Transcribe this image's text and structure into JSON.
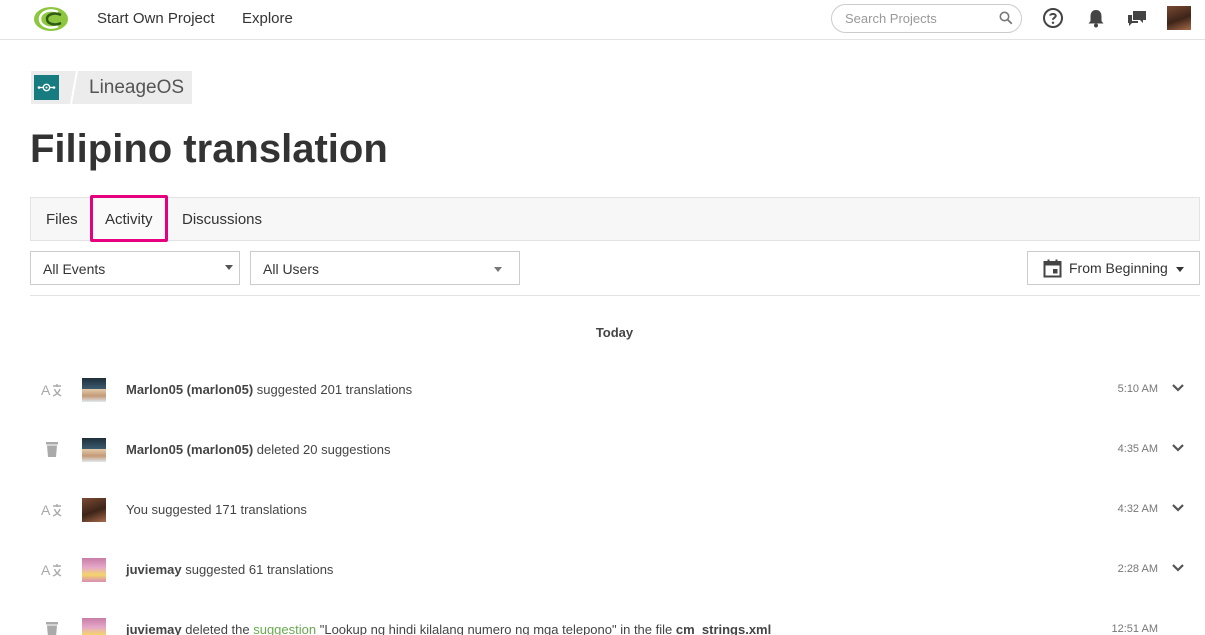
{
  "nav": {
    "start_own_project": "Start Own Project",
    "explore": "Explore",
    "search_placeholder": "Search Projects"
  },
  "breadcrumb": {
    "project": "LineageOS"
  },
  "page": {
    "title": "Filipino translation"
  },
  "tabs": {
    "files": "Files",
    "activity": "Activity",
    "discussions": "Discussions",
    "active": "Activity"
  },
  "filters": {
    "events": "All Events",
    "users": "All Users",
    "date_range": "From Beginning"
  },
  "activity": {
    "day": "Today",
    "rows": [
      {
        "icon": "translate-icon",
        "user": "Marlon05 (marlon05)",
        "action": " suggested 201 translations",
        "time": "5:10 AM"
      },
      {
        "icon": "trash-icon",
        "user": "Marlon05 (marlon05)",
        "action": " deleted 20 suggestions",
        "time": "4:35 AM"
      },
      {
        "icon": "translate-icon",
        "user": "You",
        "action": "You suggested 171 translations",
        "time": "4:32 AM"
      },
      {
        "icon": "translate-icon",
        "user": "juviemay",
        "action": " suggested 61 translations",
        "time": "2:28 AM"
      },
      {
        "icon": "trash-icon",
        "user": "juviemay",
        "action_pre": " deleted the ",
        "link": "suggestion",
        "action_mid": " \"Lookup ng hindi kilalang numero ng mga telepono\" in the file ",
        "file": "cm_strings.xml",
        "time": "12:51 AM"
      }
    ]
  },
  "colors": {
    "accent": "#e6007e",
    "project_logo": "#167c80",
    "link": "#6aa84f",
    "logo_green": "#8dc63f"
  }
}
